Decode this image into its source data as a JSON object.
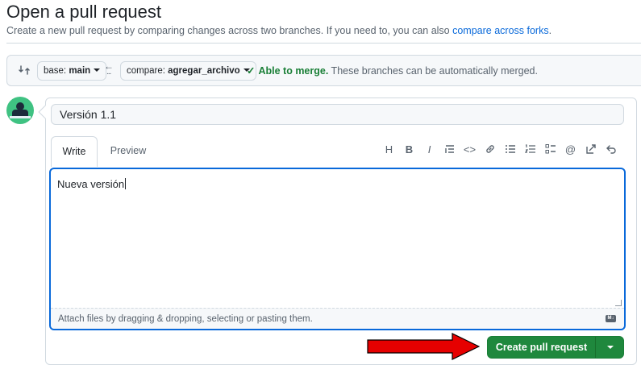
{
  "page": {
    "title": "Open a pull request",
    "subtitle_prefix": "Create a new pull request by comparing changes across two branches. If you need to, you can also ",
    "subtitle_link": "compare across forks",
    "subtitle_suffix": "."
  },
  "range": {
    "base_prefix": "base: ",
    "base_branch": "main",
    "compare_prefix": "compare: ",
    "compare_branch": "agregar_archivo",
    "merge_check": "✓",
    "merge_ok": "Able to merge.",
    "merge_detail": " These branches can be automatically merged."
  },
  "form": {
    "title_value": "Versión 1.1",
    "tabs": [
      "Write",
      "Preview"
    ],
    "body_value": "Nueva versión",
    "attach_hint": "Attach files by dragging & dropping, selecting or pasting them.",
    "markdown_badge": "M↓"
  },
  "toolbar": {
    "heading": "H",
    "bold": "B",
    "italic": "I",
    "quote": "☰",
    "code": "<>",
    "link": "🔗",
    "bullet_list": "≡",
    "numbered_list": "≡",
    "task_list": "☷",
    "mention": "@",
    "reference": "↗",
    "undo": "↶"
  },
  "actions": {
    "create_label": "Create pull request"
  },
  "colors": {
    "primary_button": "#1f883d",
    "link": "#0969da",
    "merge_ok": "#1a7f37",
    "annotation_arrow": "#e60000"
  }
}
